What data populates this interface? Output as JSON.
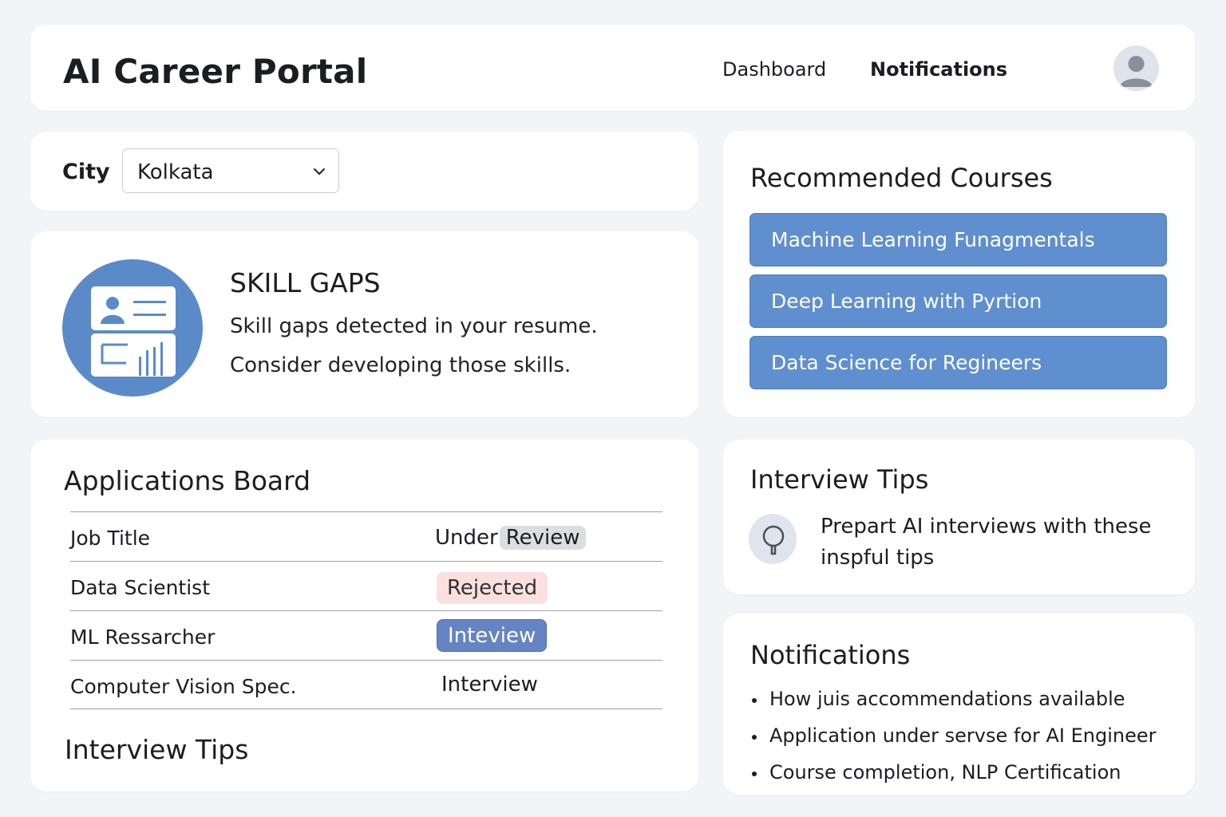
{
  "header": {
    "app_title": "AI Career Portal",
    "nav": [
      "Dashboard",
      "Notifications"
    ],
    "active_nav": "Notifications",
    "avatar_icon": "user-avatar-icon"
  },
  "city": {
    "label": "City",
    "selected": "Kolkata",
    "chevron_icon": "chevron-down-icon"
  },
  "skill_gaps": {
    "title": "SKILL GAPS",
    "line1": "Skill gaps detected in your resume.",
    "line2": "Consider developing those skills.",
    "icon": "resume-chart-icon"
  },
  "applications": {
    "title": "Applications Board",
    "rows": [
      {
        "title": "Job Title",
        "status_prefix": "Under",
        "status": "Review"
      },
      {
        "title": "Data Scientist",
        "status": "Rejected"
      },
      {
        "title": "ML Ressarcher",
        "status": "Inteview"
      },
      {
        "title": "Computer Vision Spec.",
        "status": "Interview"
      }
    ],
    "subtitle": "Interview Tips"
  },
  "courses": {
    "title": "Recommended Courses",
    "items": [
      "Machine Learning Funagmentals",
      "Deep Learning with Pyrtion",
      "Data Science for Regineers"
    ]
  },
  "tips": {
    "title": "Interview Tips",
    "line1": "Prepart AI interviews with these",
    "line2": "inspful tips",
    "icon": "lightbulb-icon"
  },
  "notifications": {
    "title": "Notifications",
    "items": [
      "How juis accommendations available",
      "Application under servse for AI Engineer",
      "Course completion, NLP Certification"
    ]
  },
  "colors": {
    "accent": "#5f8fcf",
    "icon_blue": "#5b8ac9",
    "rejected_bg": "#fbe0e0",
    "interview_bg": "#6584c3",
    "background": "#f2f4f8"
  }
}
